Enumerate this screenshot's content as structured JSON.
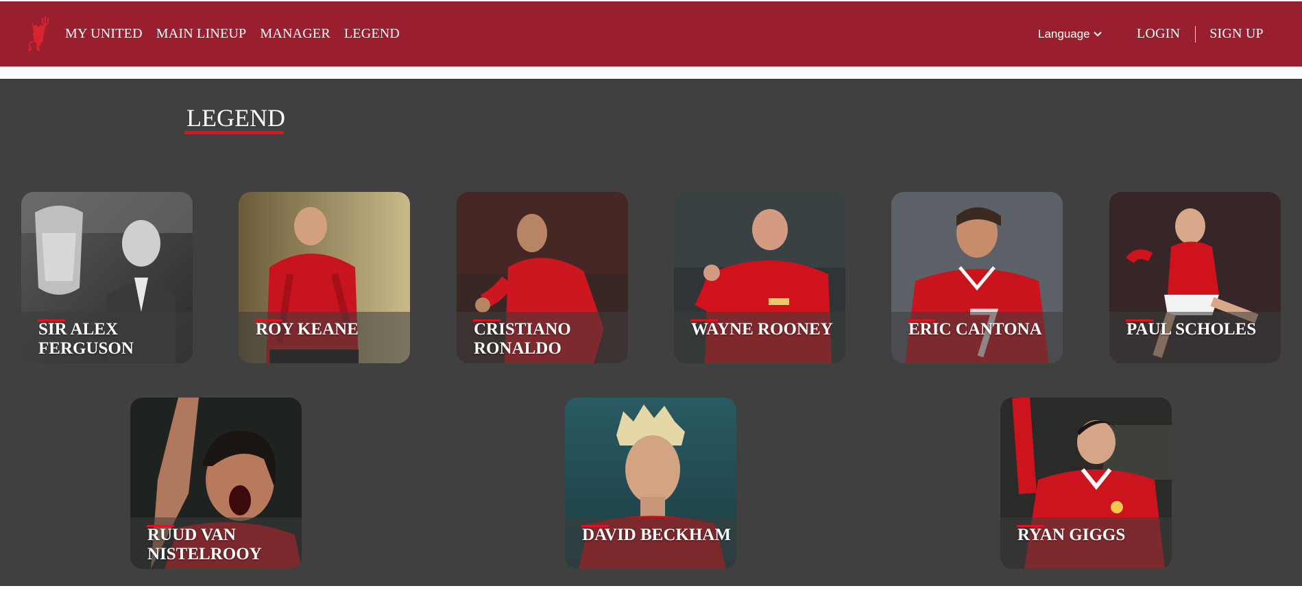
{
  "nav": {
    "links": [
      "MY UNITED",
      "MAIN LINEUP",
      "MANAGER",
      "LEGEND"
    ],
    "language_label": "Language",
    "login_label": "LOGIN",
    "signup_label": "SIGN UP"
  },
  "section": {
    "title": "LEGEND"
  },
  "legends": [
    {
      "name": "SIR ALEX FERGUSON"
    },
    {
      "name": "ROY KEANE"
    },
    {
      "name": "CRISTIANO RONALDO"
    },
    {
      "name": "WAYNE ROONEY"
    },
    {
      "name": "ERIC CANTONA"
    },
    {
      "name": "PAUL SCHOLES"
    },
    {
      "name": "RUUD VAN NISTELROOY"
    },
    {
      "name": "DAVID BECKHAM"
    },
    {
      "name": "RYAN GIGGS"
    }
  ],
  "colors": {
    "brand": "#9a1f2e",
    "accent": "#e0121e",
    "background": "#404040"
  },
  "icons": {
    "logo": "red-devil-crest-icon",
    "language_caret": "chevron-down-icon"
  }
}
